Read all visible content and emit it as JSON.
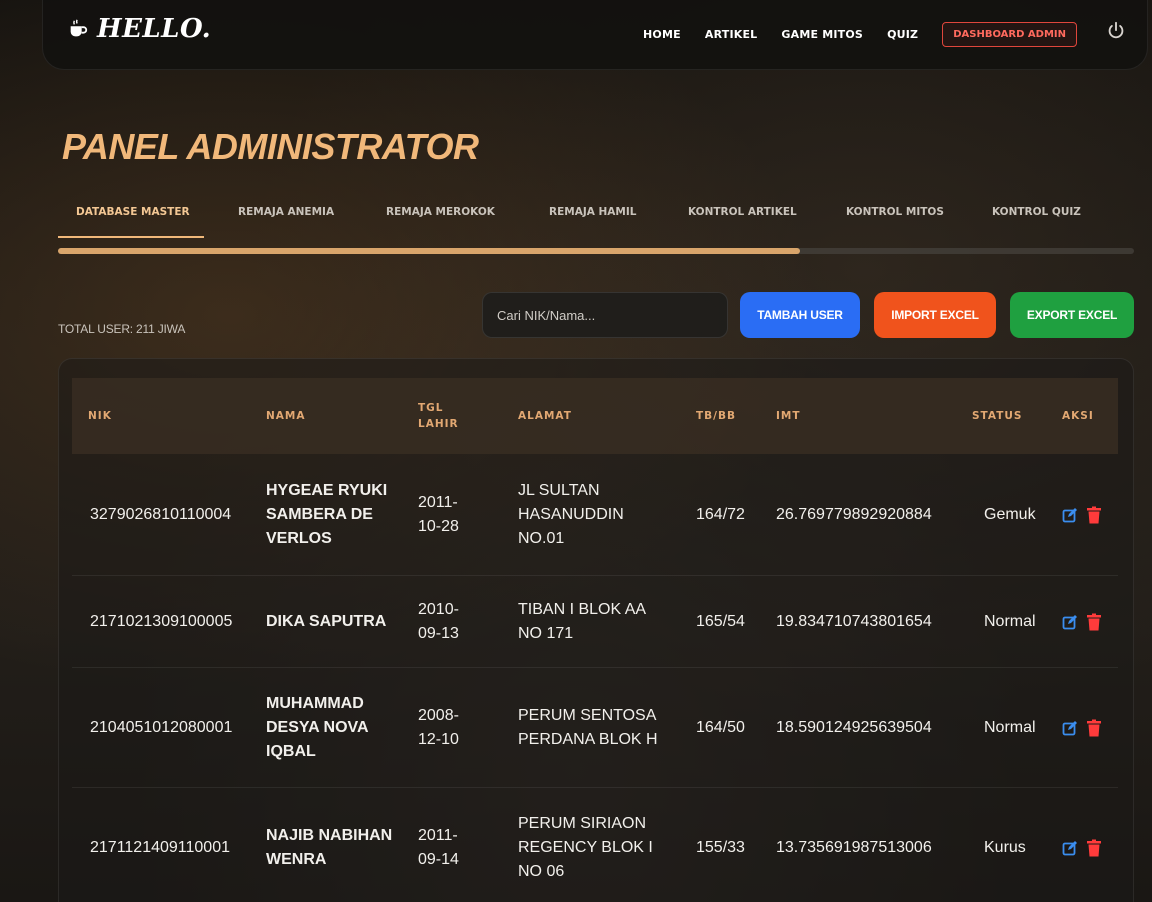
{
  "navbar": {
    "brand": "HELLO.",
    "links": [
      "HOME",
      "ARTIKEL",
      "GAME MITOS",
      "QUIZ"
    ],
    "admin_button": "DASHBOARD ADMIN"
  },
  "page_title": "PANEL ADMINISTRATOR",
  "tabs": [
    "DATABASE MASTER",
    "REMAJA ANEMIA",
    "REMAJA MEROKOK",
    "REMAJA HAMIL",
    "KONTROL ARTIKEL",
    "KONTROL MITOS",
    "KONTROL QUIZ"
  ],
  "active_tab": "DATABASE MASTER",
  "tab_scroll_fraction": 0.69,
  "toolbar": {
    "total_label": "TOTAL USER: 211 JIWA",
    "search_placeholder": "Cari NIK/Nama...",
    "tambah_label": "TAMBAH USER",
    "import_label": "IMPORT EXCEL",
    "export_label": "EXPORT EXCEL"
  },
  "table": {
    "headers": {
      "nik": "NIK",
      "nama": "NAMA",
      "tgl_lahir": "TGL LAHIR",
      "alamat": "ALAMAT",
      "tbbb": "TB/BB",
      "imt": "IMT",
      "status": "STATUS",
      "aksi": "AKSI"
    },
    "rows": [
      {
        "nik": "3279026810110004",
        "nama": "HYGEAE RYUKI SAMBERA DE VERLOS",
        "tgl": "2011-10-28",
        "alamat": "JL SULTAN HASANUDDIN NO.01",
        "tbbb": "164/72",
        "imt": "26.769779892920884",
        "status": "Gemuk"
      },
      {
        "nik": "2171021309100005",
        "nama": "DIKA SAPUTRA",
        "tgl": "2010-09-13",
        "alamat": "TIBAN I BLOK AA NO 171",
        "tbbb": "165/54",
        "imt": "19.834710743801654",
        "status": "Normal"
      },
      {
        "nik": "2104051012080001",
        "nama": "MUHAMMAD DESYA NOVA IQBAL",
        "tgl": "2008-12-10",
        "alamat": "PERUM SENTOSA PERDANA BLOK H",
        "tbbb": "164/50",
        "imt": "18.590124925639504",
        "status": "Normal"
      },
      {
        "nik": "2171121409110001",
        "nama": "NAJIB NABIHAN WENRA",
        "tgl": "2011-09-14",
        "alamat": "PERUM SIRIAON REGENCY BLOK I NO 06",
        "tbbb": "155/33",
        "imt": "13.735691987513006",
        "status": "Kurus"
      }
    ]
  },
  "colors": {
    "accent": "#f1b87a",
    "header_text": "#e2a872",
    "edit_icon": "#3b8ef0",
    "delete_icon": "#ff3b3b",
    "blue": "#2a6df4",
    "orange": "#f0531c",
    "green": "#1fa040",
    "danger": "#e0463c"
  }
}
